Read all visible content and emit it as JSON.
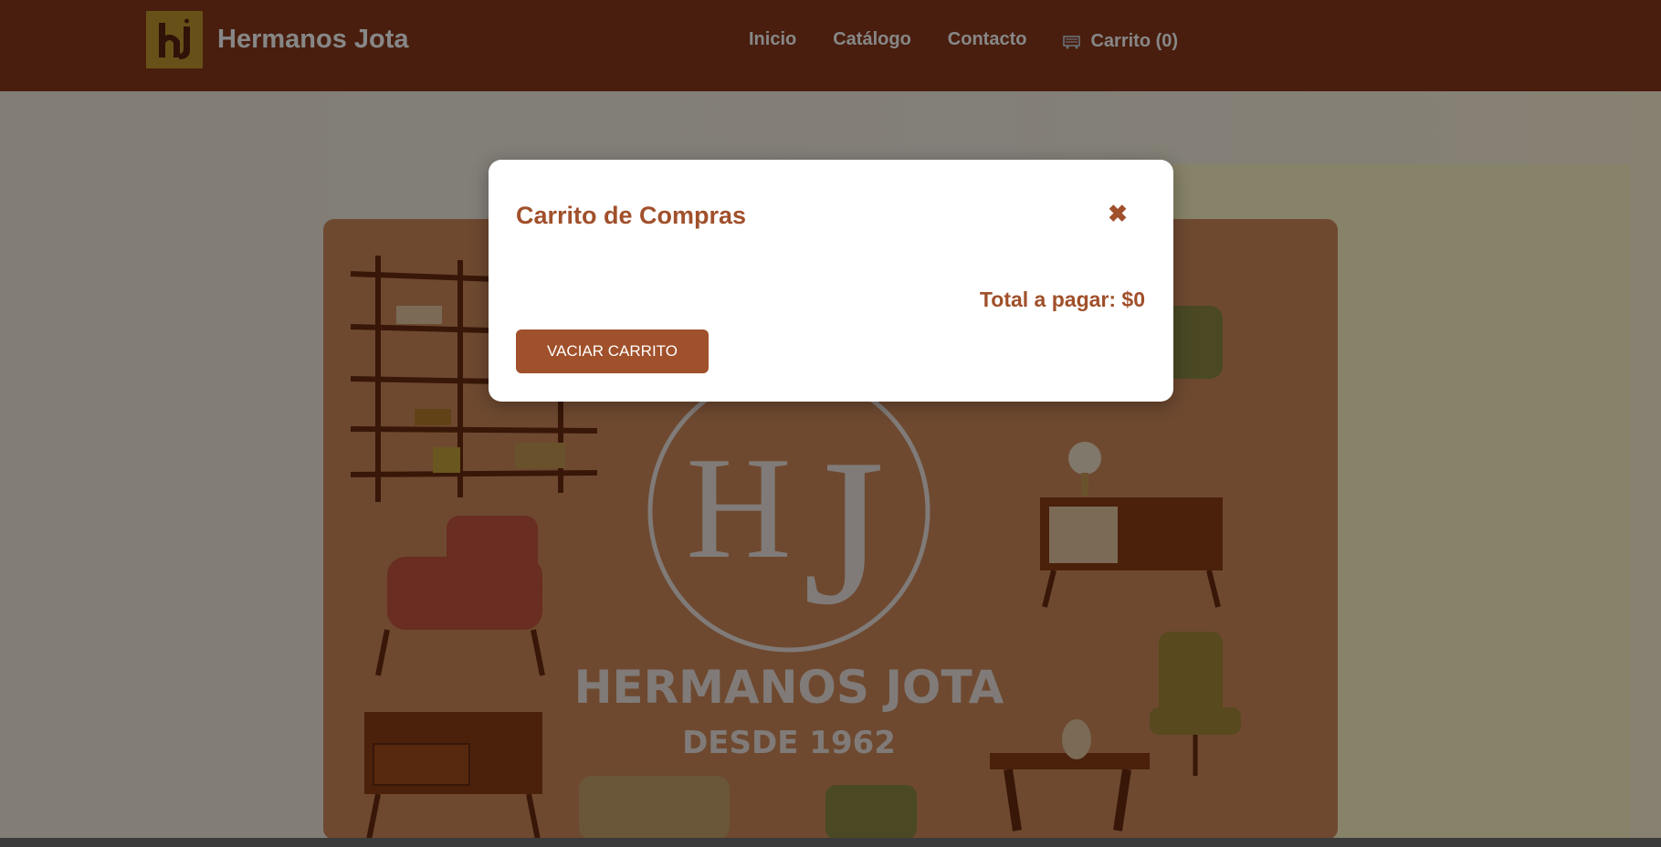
{
  "navbar": {
    "logo_text": "hj",
    "brand_name": "Hermanos Jota",
    "links": [
      "Inicio",
      "Catálogo",
      "Contacto"
    ],
    "cart_label": "Carrito (0)",
    "cart_icon": "cart-icon"
  },
  "hero": {
    "monogram_h": "H",
    "monogram_j": "J",
    "brand_title": "HERMANOS JOTA",
    "since": "DESDE 1962"
  },
  "modal": {
    "title": "Carrito de Compras",
    "close_symbol": "✖",
    "total_label": "Total a pagar: $0",
    "empty_button": "VACIAR CARRITO"
  },
  "colors": {
    "navbar": "#8b3a1c",
    "accent": "#a0502b",
    "logo": "#c49a30",
    "hero_card": "#d08a5c"
  }
}
